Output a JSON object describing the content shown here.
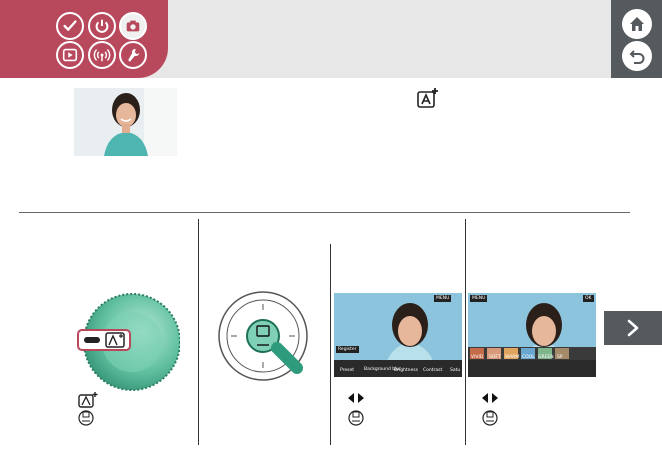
{
  "header": {
    "icons": [
      "checkmark-icon",
      "power-icon",
      "camera-icon",
      "playback-icon",
      "wireless-icon",
      "wrench-icon"
    ],
    "active": "camera-icon",
    "colors": {
      "tab": "#b8485c",
      "bar": "#e7e7e7",
      "nav": "#555a5f"
    }
  },
  "nav": {
    "home_icon": "home-icon",
    "back_icon": "back-icon",
    "next_icon": "next-arrow-icon"
  },
  "screen1": {
    "badge_top": "MENU",
    "register": "Register",
    "bottom": [
      "Preset",
      "Background blur",
      "Brightness",
      "Contrast",
      "Satu"
    ]
  },
  "screen2": {
    "badge_left": "MENU",
    "badge_right": "OK",
    "filters": [
      "VIVID",
      "SOFT",
      "WARM",
      "COOL",
      "GREEN",
      "SP"
    ]
  },
  "steps": [
    {
      "icons": [
        "auto-plus-icon",
        "set-button-icon"
      ]
    },
    {
      "icons": []
    },
    {
      "icons": [
        "left-right-arrows-icon",
        "set-button-icon"
      ]
    },
    {
      "icons": [
        "left-right-arrows-icon",
        "set-button-icon"
      ]
    }
  ]
}
